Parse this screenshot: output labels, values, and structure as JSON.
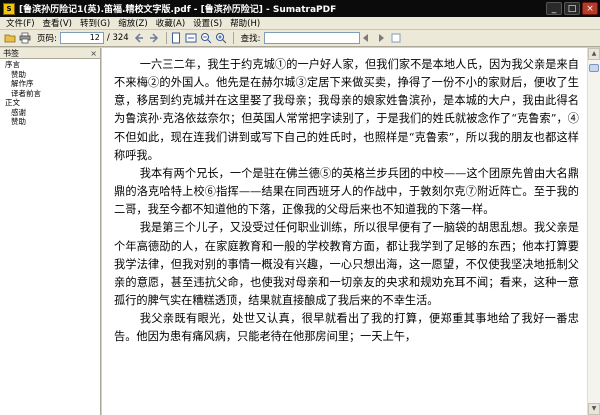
{
  "window": {
    "title": "[鲁滨孙历险记1(英).笛福.精校文字版.pdf - [鲁滨孙历险记] - SumatraPDF",
    "icon_letter": "S"
  },
  "menu": [
    "文件(F)",
    "查看(V)",
    "转到(G)",
    "缩放(Z)",
    "收藏(A)",
    "设置(S)",
    "帮助(H)"
  ],
  "toolbar": {
    "page_label": "页码:",
    "page_value": "12",
    "page_total": "/ 324",
    "find_label": "查找:",
    "find_value": ""
  },
  "sidebar": {
    "header": "书签",
    "close": "×",
    "items": [
      {
        "label": "序言",
        "level": 1
      },
      {
        "label": "赞助",
        "level": 2
      },
      {
        "label": "解作序",
        "level": 2
      },
      {
        "label": "译者前言",
        "level": 2
      },
      {
        "label": "正文",
        "level": 1
      },
      {
        "label": "感谢",
        "level": 2
      },
      {
        "label": "赞助",
        "level": 2
      }
    ]
  },
  "document": {
    "paragraphs": [
      "一六三二年，我生于约克城①的一户好人家，但我们家不是本地人氏，因为我父亲是来自不来梅②的外国人。他先是在赫尔城③定居下来做买卖，挣得了一份不小的家财后，便收了生意，移居到约克城并在这里娶了我母亲；我母亲的娘家姓鲁滨孙，是本城的大户，我由此得名为鲁滨孙·克洛依兹奈尔；但英国人常常把字读别了，于是我们的姓氏就被念作了“克鲁索”，④不但如此，现在连我们讲到或写下自己的姓氏时，也照样是“克鲁索”，所以我的朋友也都这样称呼我。",
      "我本有两个兄长，一个是驻在佛兰德⑤的英格兰步兵团的中校——这个团原先曾由大名鼎鼎的洛克哈特上校⑥指挥——结果在同西班牙人的作战中，于敦刻尔克⑦附近阵亡。至于我的二哥，我至今都不知道他的下落，正像我的父母后来也不知道我的下落一样。",
      "我是第三个儿子，又没受过任何职业训练，所以很早便有了一脑袋的胡思乱想。我父亲是个年高德劭的人，在家庭教育和一般的学校教育方面，都让我学到了足够的东西；他本打算要我学法律，但我对别的事情一概没有兴趣，一心只想出海，这一愿望，不仅使我坚决地抵制父亲的意愿，甚至违抗父命，也使我对母亲和一切亲友的央求和规劝充耳不闻；看来，这种一意孤行的脾气实在糟糕透顶，结果就直接酿成了我后来的不幸生活。",
      "我父亲既有眼光，处世又认真，很早就看出了我的打算，便郑重其事地给了我好一番忠告。他因为患有痛风病，只能老待在他那房间里；一天上午，"
    ]
  }
}
